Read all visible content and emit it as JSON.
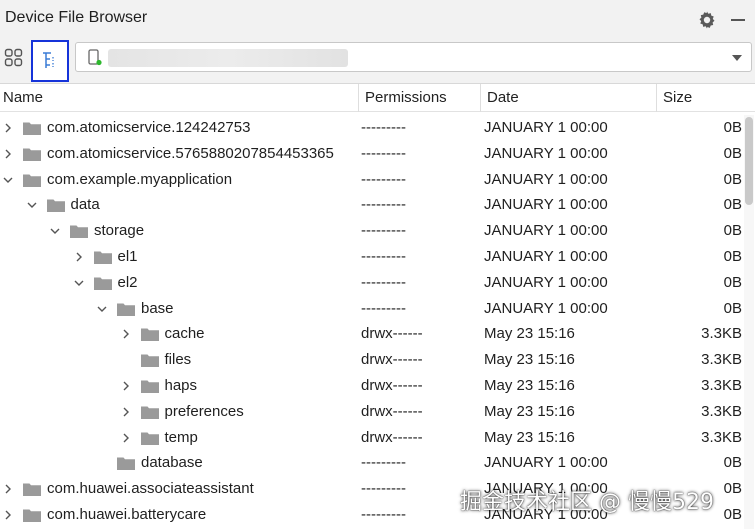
{
  "window": {
    "title": "Device File Browser"
  },
  "toolbar": {
    "device_name": ""
  },
  "columns": {
    "name": "Name",
    "permissions": "Permissions",
    "date": "Date",
    "size": "Size"
  },
  "rows": [
    {
      "depth": 0,
      "expander": "collapsed",
      "name": "com.atomicservice.124242753",
      "permissions": "---------",
      "date": "JANUARY 1 00:00",
      "size": "0B"
    },
    {
      "depth": 0,
      "expander": "collapsed",
      "name": "com.atomicservice.5765880207854453365",
      "permissions": "---------",
      "date": "JANUARY 1 00:00",
      "size": "0B"
    },
    {
      "depth": 0,
      "expander": "expanded",
      "name": "com.example.myapplication",
      "permissions": "---------",
      "date": "JANUARY 1 00:00",
      "size": "0B"
    },
    {
      "depth": 1,
      "expander": "expanded",
      "name": "data",
      "permissions": "---------",
      "date": "JANUARY 1 00:00",
      "size": "0B"
    },
    {
      "depth": 2,
      "expander": "expanded",
      "name": "storage",
      "permissions": "---------",
      "date": "JANUARY 1 00:00",
      "size": "0B"
    },
    {
      "depth": 3,
      "expander": "collapsed",
      "name": "el1",
      "permissions": "---------",
      "date": "JANUARY 1 00:00",
      "size": "0B"
    },
    {
      "depth": 3,
      "expander": "expanded",
      "name": "el2",
      "permissions": "---------",
      "date": "JANUARY 1 00:00",
      "size": "0B"
    },
    {
      "depth": 4,
      "expander": "expanded",
      "name": "base",
      "permissions": "---------",
      "date": "JANUARY 1 00:00",
      "size": "0B"
    },
    {
      "depth": 5,
      "expander": "collapsed",
      "name": "cache",
      "permissions": "drwx------",
      "date": "May 23 15:16",
      "size": "3.3KB"
    },
    {
      "depth": 5,
      "expander": "none",
      "name": "files",
      "permissions": "drwx------",
      "date": "May 23 15:16",
      "size": "3.3KB"
    },
    {
      "depth": 5,
      "expander": "collapsed",
      "name": "haps",
      "permissions": "drwx------",
      "date": "May 23 15:16",
      "size": "3.3KB"
    },
    {
      "depth": 5,
      "expander": "collapsed",
      "name": "preferences",
      "permissions": "drwx------",
      "date": "May 23 15:16",
      "size": "3.3KB"
    },
    {
      "depth": 5,
      "expander": "collapsed",
      "name": "temp",
      "permissions": "drwx------",
      "date": "May 23 15:16",
      "size": "3.3KB"
    },
    {
      "depth": 4,
      "expander": "none",
      "name": "database",
      "permissions": "---------",
      "date": "JANUARY 1 00:00",
      "size": "0B"
    },
    {
      "depth": 0,
      "expander": "collapsed",
      "name": "com.huawei.associateassistant",
      "permissions": "---------",
      "date": "JANUARY 1 00:00",
      "size": "0B"
    },
    {
      "depth": 0,
      "expander": "collapsed",
      "name": "com.huawei.batterycare",
      "permissions": "---------",
      "date": "JANUARY 1 00:00",
      "size": "0B"
    }
  ],
  "watermark": "掘金技术社区 @ 慢慢529",
  "colors": {
    "selected_border": "#1533d9",
    "folder": "#9a9a9a",
    "chrome": "#f2f2f2"
  },
  "icons": {
    "settings": "gear-icon",
    "view_toggle": "grid-icon",
    "tree_view": "tree-view-icon",
    "device": "phone-icon",
    "folder": "folder-icon"
  }
}
